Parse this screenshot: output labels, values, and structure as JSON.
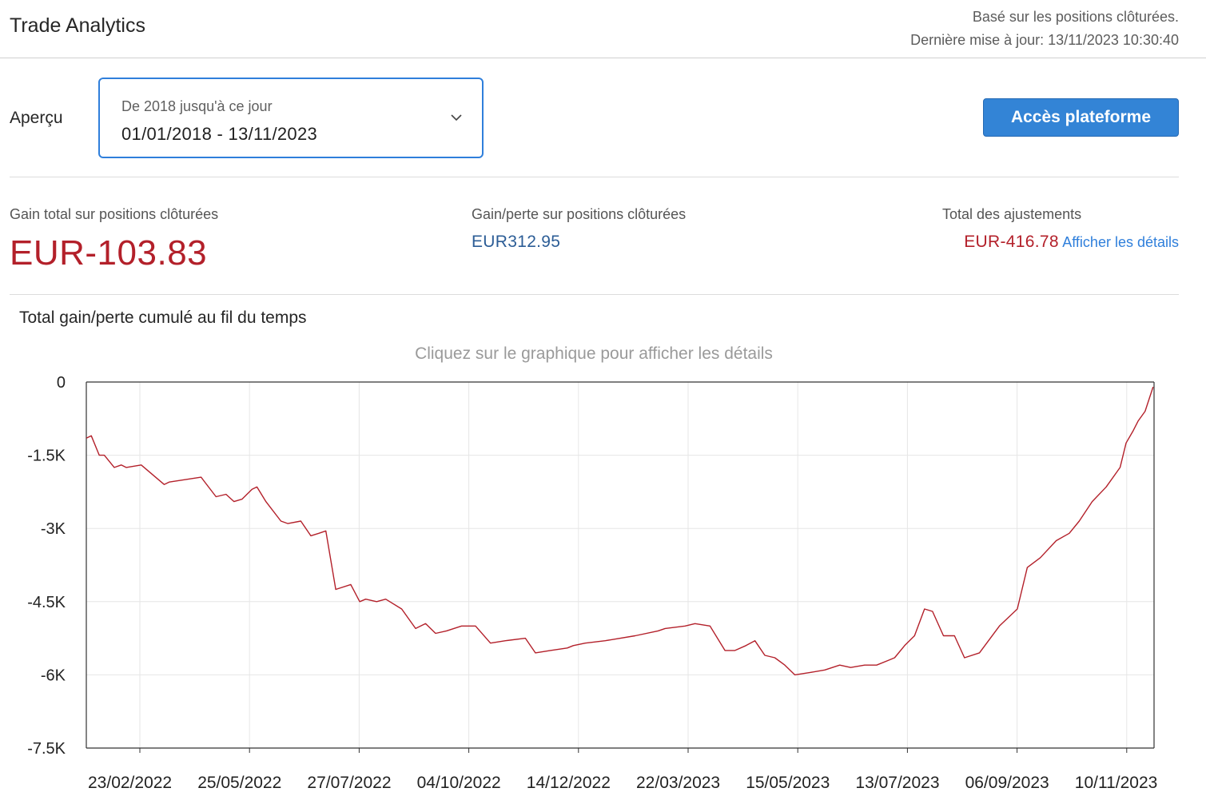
{
  "header": {
    "title": "Trade Analytics",
    "meta_line1": "Basé sur les positions clôturées.",
    "meta_line2": "Dernière mise à jour: 13/11/2023 10:30:40"
  },
  "filter": {
    "label": "Aperçu",
    "caption": "De 2018 jusqu'à ce jour",
    "value": "01/01/2018 - 13/11/2023",
    "icon": "chevron-down-icon"
  },
  "actions": {
    "platform_button": "Accès plateforme"
  },
  "stats": {
    "total_gain_label": "Gain total sur positions clôturées",
    "total_gain_value": "EUR-103.83",
    "pl_label": "Gain/perte sur positions clôturées",
    "pl_value": "EUR312.95",
    "adjustments_label": "Total des ajustements",
    "adjustments_value": "EUR-416.78",
    "details_link": "Afficher les détails"
  },
  "colors": {
    "negative": "#b3202a",
    "positive": "#2c5d96",
    "accent": "#3384d6",
    "line": "#b3202a"
  },
  "chart_data": {
    "type": "line",
    "title": "Total gain/perte cumulé au fil du temps",
    "hint": "Cliquez sur le graphique pour afficher les détails",
    "ylim": [
      -7500,
      0
    ],
    "yticks": [
      0,
      -1500,
      -3000,
      -4500,
      -6000,
      -7500
    ],
    "ytick_labels": [
      "0",
      "-1.5K",
      "-3K",
      "-4.5K",
      "-6K",
      "-7.5K"
    ],
    "xtick_labels": [
      "23/02/2022",
      "25/05/2022",
      "27/07/2022",
      "04/10/2022",
      "14/12/2022",
      "22/03/2023",
      "15/05/2023",
      "13/07/2023",
      "06/09/2023",
      "10/11/2023"
    ],
    "grid": true,
    "series": [
      {
        "x": [
          0,
          0.5,
          1.3,
          1.8,
          2.8,
          3.5,
          4,
          5.5,
          7.8,
          8.3,
          11.5,
          13,
          14,
          14.8,
          15.6,
          16.6,
          17.1,
          18,
          19.5,
          20.2,
          21.5,
          22.5,
          23.3,
          24,
          25,
          26.5,
          27.4,
          28,
          29.1,
          30,
          31.6,
          33,
          34,
          35,
          36.1,
          37.6,
          39,
          40.5,
          42,
          44,
          45,
          46.5,
          48.2,
          48.8,
          50,
          52,
          55,
          57.3,
          58,
          60,
          61,
          62.5,
          64,
          65,
          66.1,
          67,
          68,
          69,
          70,
          71,
          72.6,
          74,
          75.5,
          76.6,
          78,
          79.2,
          80.4,
          81,
          82,
          83,
          84,
          84.8,
          85.9,
          86.5,
          87,
          88,
          89.5,
          91.5,
          93.3,
          94.3,
          95.6,
          97.2,
          98.5,
          99.5,
          100.8,
          102.2,
          103.6,
          104.2,
          104.9,
          105.4,
          106.1,
          106.9
        ],
        "y": [
          -1150,
          -1100,
          -1500,
          -1500,
          -1750,
          -1700,
          -1750,
          -1700,
          -2100,
          -2050,
          -1950,
          -2350,
          -2300,
          -2450,
          -2400,
          -2200,
          -2150,
          -2450,
          -2850,
          -2900,
          -2850,
          -3150,
          -3100,
          -3050,
          -4250,
          -4150,
          -4500,
          -4450,
          -4500,
          -4450,
          -4650,
          -5050,
          -4950,
          -5150,
          -5100,
          -5000,
          -5000,
          -5350,
          -5300,
          -5250,
          -5550,
          -5500,
          -5450,
          -5400,
          -5350,
          -5300,
          -5200,
          -5100,
          -5050,
          -5000,
          -4950,
          -5000,
          -5500,
          -5500,
          -5400,
          -5300,
          -5600,
          -5650,
          -5800,
          -6000,
          -5950,
          -5900,
          -5800,
          -5850,
          -5800,
          -5800,
          -5700,
          -5650,
          -5400,
          -5200,
          -4650,
          -4700,
          -5200,
          -5200,
          -5200,
          -5650,
          -5550,
          -5000,
          -4650,
          -3800,
          -3600,
          -3250,
          -3100,
          -2850,
          -2450,
          -2150,
          -1750,
          -1250,
          -1000,
          -800,
          -600,
          -100
        ],
        "x_note_units": "weeks"
      }
    ]
  }
}
